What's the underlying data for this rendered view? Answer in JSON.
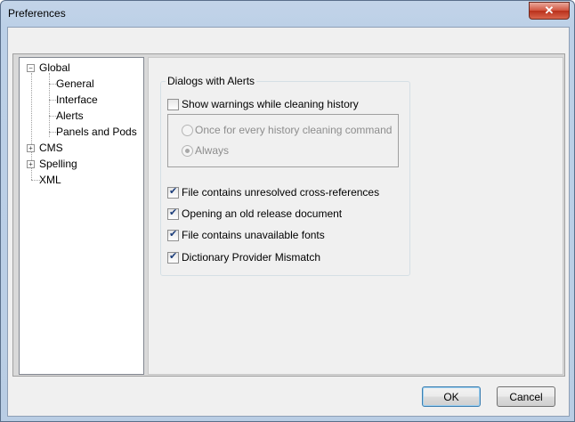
{
  "window": {
    "title": "Preferences",
    "close_glyph": "✕"
  },
  "tree": {
    "items": [
      {
        "label": "Global",
        "expander": "−"
      },
      {
        "label": "General"
      },
      {
        "label": "Interface"
      },
      {
        "label": "Alerts",
        "selected": true
      },
      {
        "label": "Panels and Pods"
      },
      {
        "label": "CMS",
        "expander": "+"
      },
      {
        "label": "Spelling",
        "expander": "+"
      },
      {
        "label": "XML"
      }
    ]
  },
  "alerts": {
    "group_title": "Dialogs with Alerts",
    "show_warnings": {
      "label": "Show warnings while cleaning history",
      "checked": false
    },
    "radios": [
      {
        "label": "Once for every history cleaning command",
        "selected": false
      },
      {
        "label": "Always",
        "selected": true
      }
    ],
    "checks": [
      {
        "label": "File contains unresolved cross-references",
        "checked": true
      },
      {
        "label": "Opening an old release document",
        "checked": true
      },
      {
        "label": "File contains unavailable fonts",
        "checked": true
      },
      {
        "label": "Dictionary Provider Mismatch",
        "checked": true
      }
    ]
  },
  "buttons": {
    "ok": "OK",
    "cancel": "Cancel"
  },
  "colors": {
    "frame": "#b9cde4",
    "close": "#c7432c",
    "default_button": "#3c7fb1"
  }
}
